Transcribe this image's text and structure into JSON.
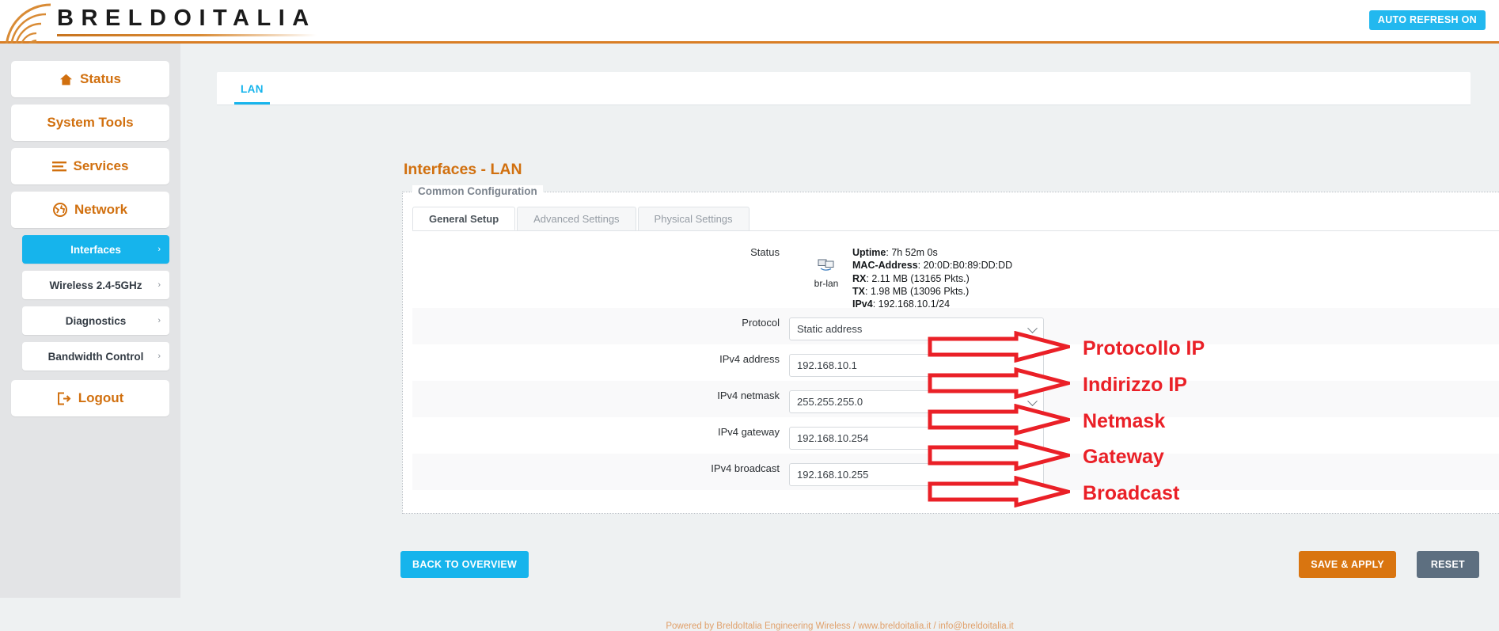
{
  "header": {
    "logo_text": "BRELDOITALIA",
    "auto_refresh_label": "AUTO REFRESH ON",
    "accent_orange": "#d1700f",
    "accent_cyan": "#16b4ec"
  },
  "sidebar": {
    "items": [
      {
        "label": "Status",
        "icon": "home-icon"
      },
      {
        "label": "System Tools",
        "icon": "none"
      },
      {
        "label": "Services",
        "icon": "list-icon"
      },
      {
        "label": "Network",
        "icon": "globe-icon"
      }
    ],
    "subitems": [
      {
        "label": "Interfaces",
        "chevron": "›",
        "active": true
      },
      {
        "label": "Wireless 2.4-5GHz",
        "chevron": "›",
        "active": false
      },
      {
        "label": "Diagnostics",
        "chevron": "›",
        "active": false
      },
      {
        "label": "Bandwidth Control",
        "chevron": "›",
        "active": false
      }
    ],
    "logout": {
      "label": "Logout",
      "icon": "logout-icon"
    }
  },
  "main": {
    "tab_lan": "LAN",
    "page_title": "Interfaces - LAN",
    "legend": "Common Configuration",
    "inner_tabs": [
      {
        "label": "General Setup",
        "active": true
      },
      {
        "label": "Advanced Settings",
        "active": false
      },
      {
        "label": "Physical Settings",
        "active": false
      }
    ],
    "status": {
      "label": "Status",
      "iface_name": "br-lan",
      "iface_icon": "network-interface-icon",
      "lines": [
        {
          "key": "Uptime",
          "value": "7h 52m 0s"
        },
        {
          "key": "MAC-Address",
          "value": "20:0D:B0:89:DD:DD"
        },
        {
          "key": "RX",
          "value": "2.11 MB (13165 Pkts.)"
        },
        {
          "key": "TX",
          "value": "1.98 MB (13096 Pkts.)"
        },
        {
          "key": "IPv4",
          "value": "192.168.10.1/24"
        }
      ]
    },
    "fields": [
      {
        "label": "Protocol",
        "value": "Static address",
        "type": "select"
      },
      {
        "label": "IPv4 address",
        "value": "192.168.10.1",
        "type": "text"
      },
      {
        "label": "IPv4 netmask",
        "value": "255.255.255.0",
        "type": "select"
      },
      {
        "label": "IPv4 gateway",
        "value": "192.168.10.254",
        "type": "text"
      },
      {
        "label": "IPv4 broadcast",
        "value": "192.168.10.255",
        "type": "text"
      }
    ],
    "annotations": [
      {
        "text": "Protocollo IP",
        "color": "#ea2027"
      },
      {
        "text": "Indirizzo IP",
        "color": "#ea2027"
      },
      {
        "text": "Netmask",
        "color": "#ea2027"
      },
      {
        "text": "Gateway",
        "color": "#ea2027"
      },
      {
        "text": "Broadcast",
        "color": "#ea2027"
      }
    ],
    "buttons": {
      "back": "BACK TO OVERVIEW",
      "save": "SAVE & APPLY",
      "reset": "RESET"
    }
  },
  "footer": {
    "text": "Powered by BreldoItalia Engineering Wireless / www.breldoitalia.it / info@breldoitalia.it"
  }
}
